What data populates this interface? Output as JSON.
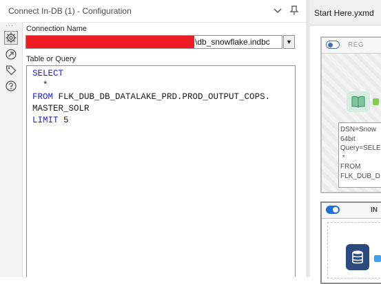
{
  "panel": {
    "title": "Connect In-DB (1) - Configuration",
    "connection_label": "Connection Name",
    "connection_value_visible": "\\db_snowflake.indbc",
    "connection_dropdown_glyph": "▼",
    "query_label": "Table or Query",
    "query_lines": [
      {
        "kw": "SELECT",
        "text": ""
      },
      {
        "kw": "",
        "text": "  *"
      },
      {
        "kw": "FROM",
        "text": " FLK_DUB_DB_DATALAKE_PRD.PROD_OUTPUT_COPS."
      },
      {
        "kw": "",
        "text": "MASTER_SOLR"
      },
      {
        "kw": "LIMIT",
        "text": " 5"
      }
    ],
    "rail_dots": "..."
  },
  "icons": {
    "collapse": "chevron-down-icon",
    "pin": "pin-icon",
    "rail": [
      "gear-icon",
      "connection-icon",
      "tag-icon",
      "help-icon"
    ]
  },
  "canvas": {
    "tab_label": "Start Here.yxmd",
    "container1_title": "REG",
    "annotation": "DSN=Snow\n64bit\nQuery=SELE\n *\nFROM\nFLK_DUB_D",
    "container2_title": "IN"
  },
  "colors": {
    "keyword": "#1f1fd0",
    "redaction": "#ee1c24",
    "toggle_on": "#1f6fd8",
    "tool_anchor_green": "#7fd14a",
    "db_tool": "#2c4a7e"
  }
}
